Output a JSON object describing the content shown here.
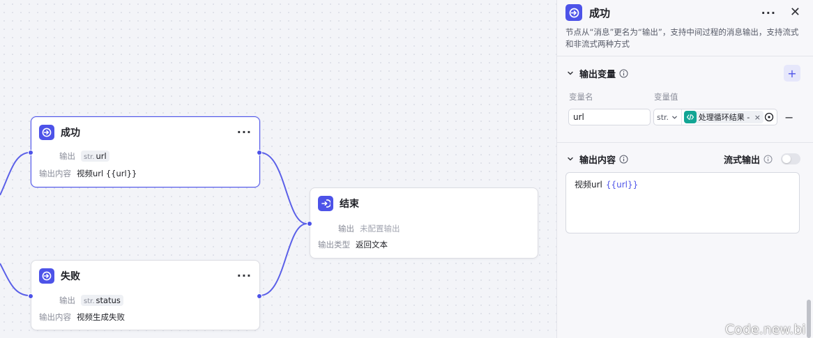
{
  "canvas": {
    "nodes": {
      "success": {
        "title": "成功",
        "more": "···",
        "output_label": "输出",
        "output_type": "str.",
        "output_var": "url",
        "content_label": "输出内容",
        "content_value": "视频url {{url}}"
      },
      "end": {
        "title": "结束",
        "output_label": "输出",
        "output_value": "未配置输出",
        "type_label": "输出类型",
        "type_value": "返回文本"
      },
      "failure": {
        "title": "失败",
        "more": "···",
        "output_label": "输出",
        "output_type": "str.",
        "output_var": "status",
        "content_label": "输出内容",
        "content_value": "视频生成失败"
      }
    }
  },
  "panel": {
    "title": "成功",
    "more": "···",
    "close": "✕",
    "description": "节点从“消息”更名为“输出”，支持中间过程的消息输出，支持流式和非流式两种方式",
    "output_vars": {
      "title": "输出变量",
      "add": "+",
      "col_name": "变量名",
      "col_value": "变量值",
      "rows": [
        {
          "name": "url",
          "type": "str.",
          "ref_label": "处理循环结果 - url",
          "remove": "−"
        }
      ]
    },
    "output_content": {
      "title": "输出内容",
      "stream_label": "流式输出",
      "stream_enabled": false,
      "text": "视频url",
      "var": "{{url}}"
    }
  },
  "watermark": "Code.new.bi",
  "colors": {
    "accent": "#4d53e8",
    "ref_icon": "#12a594",
    "edge": "#5b60e8"
  }
}
